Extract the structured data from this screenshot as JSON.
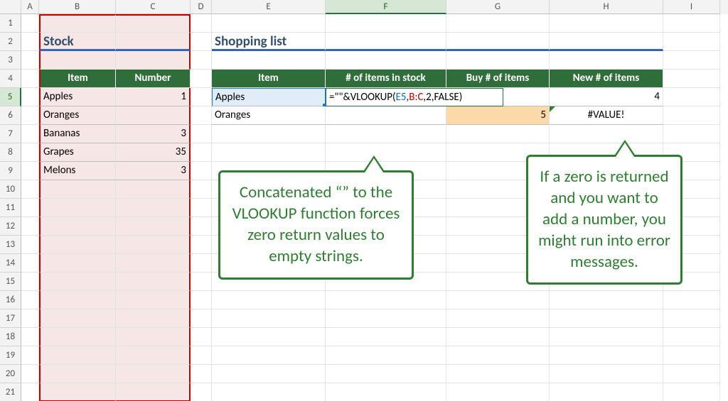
{
  "columns": [
    "A",
    "B",
    "C",
    "D",
    "E",
    "F",
    "G",
    "H",
    "I"
  ],
  "rows": [
    "1",
    "2",
    "3",
    "4",
    "5",
    "6",
    "7",
    "8",
    "9",
    "10",
    "11",
    "12",
    "13",
    "14",
    "15",
    "16",
    "17",
    "18",
    "19",
    "20",
    "21"
  ],
  "active_col": "F",
  "active_row": "5",
  "stock": {
    "title": "Stock",
    "head_item": "Item",
    "head_number": "Number",
    "rows": [
      {
        "item": "Apples",
        "number": "1"
      },
      {
        "item": "Oranges",
        "number": ""
      },
      {
        "item": "Bananas",
        "number": "3"
      },
      {
        "item": "Grapes",
        "number": "35"
      },
      {
        "item": "Melons",
        "number": "3"
      }
    ]
  },
  "shopping": {
    "title": "Shopping list",
    "head_item": "Item",
    "head_stock": "# of items in stock",
    "head_buy": "Buy # of items",
    "head_new": "New # of items",
    "rows": [
      {
        "item": "Apples",
        "stock_formula": "",
        "buy": "",
        "new": "4"
      },
      {
        "item": "Oranges",
        "stock": "",
        "buy": "5",
        "new": "#VALUE!"
      }
    ]
  },
  "formula": {
    "prefix": "=\"\"&VLOOKUP(",
    "arg1": "E5",
    "comma1": ",",
    "arg2": "B:C",
    "suffix": ",2,FALSE)"
  },
  "callout_left": "Concatenated “” to the VLOOKUP function forces zero return values to empty strings.",
  "callout_right": "If a zero is returned and you want to add a number, you might run into error messages."
}
